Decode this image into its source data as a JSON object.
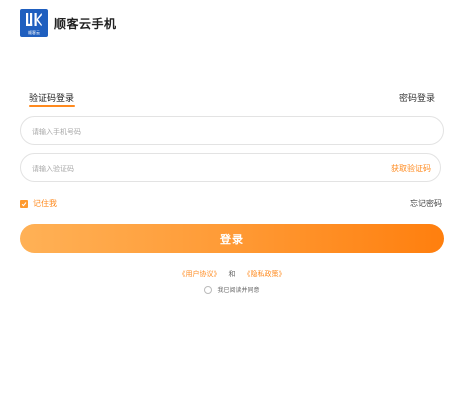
{
  "brand": {
    "name": "顺客云手机",
    "logo_mark": "UIK",
    "logo_sub": "顺客云"
  },
  "tabs": {
    "sms_login": "验证码登录",
    "password_login": "密码登录",
    "active": "sms_login"
  },
  "phone_input": {
    "placeholder": "请输入手机号码",
    "value": ""
  },
  "code_input": {
    "placeholder": "请输入验证码",
    "value": ""
  },
  "get_code_label": "获取验证码",
  "remember": {
    "label": "记住我",
    "checked": true
  },
  "forgot_label": "忘记密码",
  "login_button_label": "登录",
  "agreement": {
    "user_agreement": "《用户协议》",
    "and": "和",
    "privacy_policy": "《隐私政策》",
    "consent_label": "我已阅读并同意",
    "consent_checked": false
  },
  "colors": {
    "accent": "#ff8a1e",
    "brand_blue": "#1f5fbf"
  }
}
